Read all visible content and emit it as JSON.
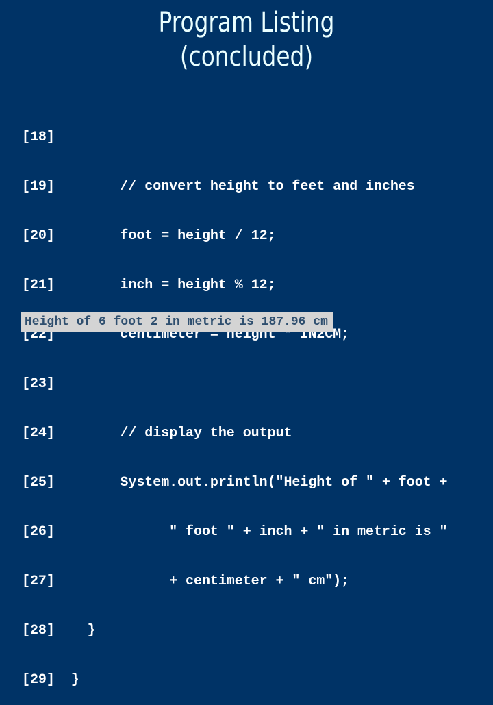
{
  "slide": {
    "title_line1": "Program Listing",
    "title_line2": "(concluded)"
  },
  "code_lines": [
    {
      "num": "[18]",
      "text": ""
    },
    {
      "num": "[19]",
      "text": "        // convert height to feet and inches"
    },
    {
      "num": "[20]",
      "text": "        foot = height / 12;"
    },
    {
      "num": "[21]",
      "text": "        inch = height % 12;"
    },
    {
      "num": "[22]",
      "text": "        centimeter = height * IN2CM;"
    },
    {
      "num": "[23]",
      "text": ""
    },
    {
      "num": "[24]",
      "text": "        // display the output"
    },
    {
      "num": "[25]",
      "text": "        System.out.println(\"Height of \" + foot +"
    },
    {
      "num": "[26]",
      "text": "              \" foot \" + inch + \" in metric is \""
    },
    {
      "num": "[27]",
      "text": "              + centimeter + \" cm\");"
    },
    {
      "num": "[28]",
      "text": "    }"
    },
    {
      "num": "[29]",
      "text": "  }"
    }
  ],
  "output": {
    "text": "Height of 6 foot 2 in metric is 187.96 cm"
  },
  "colors": {
    "background": "#003366",
    "title": "#eaffff",
    "code": "#ffffff",
    "output_bg": "#d4d4d4",
    "output_text": "#2f4f6f"
  }
}
